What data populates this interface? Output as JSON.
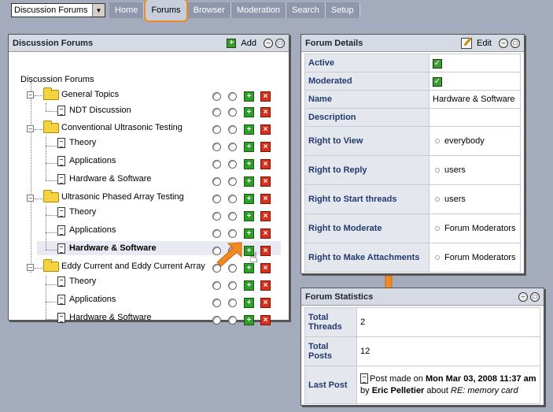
{
  "topbar": {
    "select_value": "Discussion Forums",
    "tabs": [
      {
        "label": "Home",
        "active": false
      },
      {
        "label": "Forums",
        "active": true
      },
      {
        "label": "Browser",
        "active": false
      },
      {
        "label": "Moderation",
        "active": false
      },
      {
        "label": "Search",
        "active": false
      },
      {
        "label": "Setup",
        "active": false
      }
    ]
  },
  "forums_panel": {
    "title": "Discussion Forums",
    "add_label": "Add",
    "tree_root": "Discussion Forums",
    "groups": [
      {
        "label": "General Topics",
        "children": [
          "NDT Discussion"
        ]
      },
      {
        "label": "Conventional Ultrasonic Testing",
        "children": [
          "Theory",
          "Applications",
          "Hardware & Software"
        ]
      },
      {
        "label": "Ultrasonic Phased Array Testing",
        "children": [
          "Theory",
          "Applications",
          "Hardware & Software"
        ]
      },
      {
        "label": "Eddy Current and Eddy Current Array",
        "children": [
          "Theory",
          "Applications",
          "Hardware & Software"
        ]
      }
    ]
  },
  "details_panel": {
    "title": "Forum Details",
    "edit_label": "Edit",
    "rows": {
      "active_label": "Active",
      "moderated_label": "Moderated",
      "name_label": "Name",
      "name_value": "Hardware & Software",
      "description_label": "Description",
      "view_label": "Right to View",
      "view_value": "everybody",
      "reply_label": "Right to Reply",
      "reply_value": "users",
      "start_label": "Right to Start threads",
      "start_value": "users",
      "moderate_label": "Right to Moderate",
      "moderate_value": "Forum Moderators",
      "attach_label": "Right to Make Attachments",
      "attach_value": "Forum Moderators"
    }
  },
  "stats_panel": {
    "title": "Forum Statistics",
    "threads_label_1": "Total",
    "threads_label_2": "Threads",
    "threads_value": "2",
    "posts_label_1": "Total",
    "posts_label_2": "Posts",
    "posts_value": "12",
    "last_post_label": "Last Post",
    "last_post_prefix": "Post made on",
    "last_post_date": "Mon Mar 03, 2008 11:37 am",
    "last_post_by": "by",
    "last_post_author": "Eric Pelletier",
    "last_post_about": "about",
    "last_post_subject": "RE: memory card"
  },
  "colors": {
    "background": "#a3abbd",
    "highlight_orange": "#f08a20",
    "label_blue": "#223a6e"
  }
}
